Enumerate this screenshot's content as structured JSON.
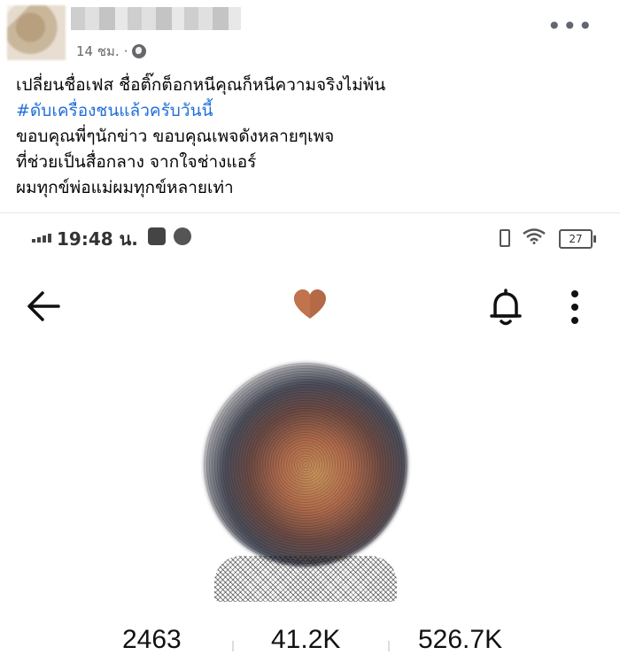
{
  "post": {
    "time": "14 ชม.",
    "privacy_icon": "globe-icon",
    "more_icon": "more-horizontal-icon",
    "lines": [
      "เปลี่ยนชื่อเฟส ชื่อติ๊กต็อกหนีคุณก็หนีความจริงไม่พ้น",
      "#ดับเครื่องชนแล้วครับวันนี้",
      "ขอบคุณพี่ๆนักข่าว   ขอบคุณเพจดังหลายๆเพจ",
      "ที่ช่วยเป็นสื่อกลาง   จากใจช่างแอร์",
      "ผมทุกข์พ่อแม่ผมทุกข์หลายเท่า"
    ],
    "hashtag_color": "#216fdb"
  },
  "phone": {
    "status": {
      "time": "19:48 น.",
      "battery": "27"
    },
    "header": {
      "back_icon": "arrow-left-icon",
      "title_icon": "brown-heart-icon",
      "bell_icon": "bell-icon",
      "menu_icon": "more-vertical-icon"
    },
    "stats": {
      "following": "2463",
      "followers": "41.2K",
      "likes": "526.7K"
    }
  }
}
